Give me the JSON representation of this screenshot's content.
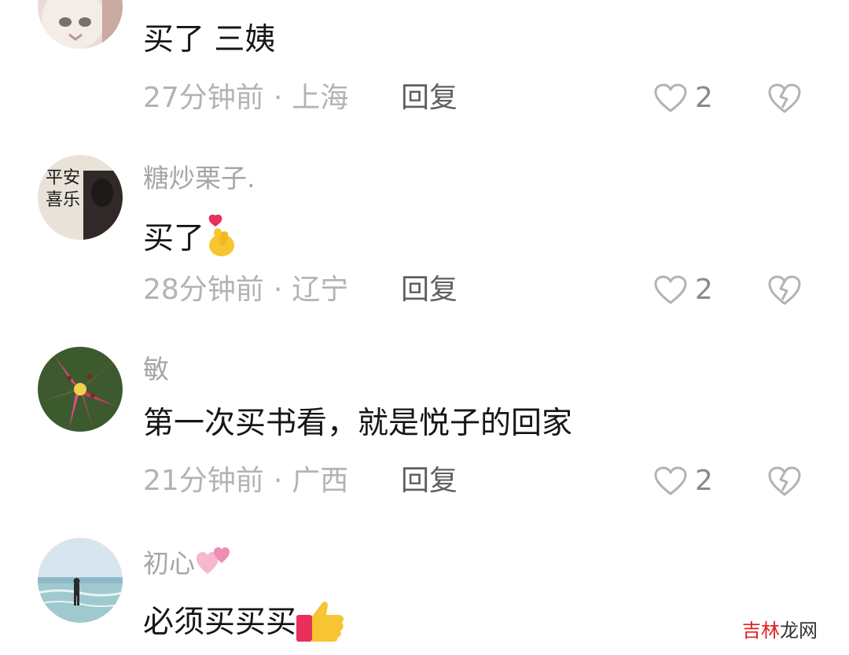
{
  "comments": [
    {
      "username": "",
      "text": "买了 三姨",
      "time": "27分钟前",
      "location": "上海",
      "reply_label": "回复",
      "likes": "2",
      "avatar": "cat-avatar"
    },
    {
      "username": "糖炒栗子.",
      "text": "买了",
      "time": "28分钟前",
      "location": "辽宁",
      "reply_label": "回复",
      "likes": "2",
      "avatar": "calligraphy-avatar",
      "avatar_text": "平安喜乐"
    },
    {
      "username": "敏",
      "text": "第一次买书看，就是悦子的回家",
      "time": "21分钟前",
      "location": "广西",
      "reply_label": "回复",
      "likes": "2",
      "avatar": "lily-flower-avatar"
    },
    {
      "username": "初心",
      "text": "必须买买买",
      "avatar": "beach-avatar"
    }
  ],
  "meta_separator": "·",
  "icons": {
    "like": "heart-outline-icon",
    "dislike": "broken-heart-icon",
    "emoji_1": "finger-heart-emoji",
    "emoji_2": "two-hearts-emoji",
    "emoji_3": "thumbs-up-emoji"
  },
  "watermark": {
    "part1": "吉林",
    "part2": "龙网"
  },
  "colors": {
    "username": "#a6a6a6",
    "text": "#161616",
    "meta": "#b3b3b3",
    "reply": "#5f5f5f",
    "watermark_red": "#e02020"
  }
}
